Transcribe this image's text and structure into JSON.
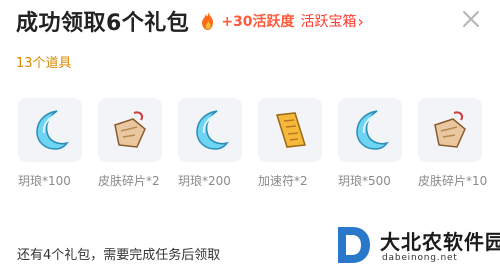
{
  "dialog": {
    "title": "成功领取6个礼包",
    "bonus": "+30活跃度",
    "active_box_link": "活跃宝箱",
    "item_count": "13个道具",
    "footer_note": "还有4个礼包，需要完成任务后领取"
  },
  "items": [
    {
      "icon": "moon-crystal-icon",
      "label": "玥琅*100"
    },
    {
      "icon": "skin-fragment-icon",
      "label": "皮肤碎片*2"
    },
    {
      "icon": "moon-crystal-icon",
      "label": "玥琅*200"
    },
    {
      "icon": "speed-talisman-icon",
      "label": "加速符*2"
    },
    {
      "icon": "moon-crystal-icon",
      "label": "玥琅*500"
    },
    {
      "icon": "skin-fragment-icon",
      "label": "皮肤碎片*10"
    }
  ],
  "watermark": {
    "brand": "大北农软件园",
    "url": "dabeinong.net"
  },
  "colors": {
    "accent": "#ff3b30",
    "count_text": "#d98a00",
    "card_bg": "#f2f4f7"
  }
}
